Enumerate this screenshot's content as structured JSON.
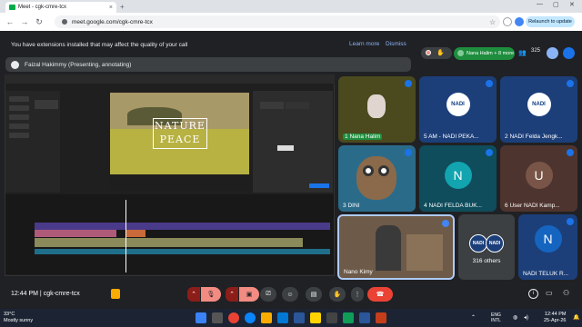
{
  "browser": {
    "tab_title": "Meet - cgk-cmre-tcx",
    "url": "meet.google.com/cgk-cmre-tcx",
    "relaunch_label": "Relaunch to update"
  },
  "banner": {
    "message": "You have extensions installed that may affect the quality of your call",
    "learn_more": "Learn more",
    "dismiss": "Dismiss"
  },
  "presenter": {
    "text": "Faizal Hakimmy (Presenting, annotating)"
  },
  "top_controls": {
    "participants_label": "Nana Halim + 8 more",
    "people_count": "325"
  },
  "shared_screen": {
    "overlay_line1": "NATURE",
    "overlay_line2": "PEACE"
  },
  "tiles": [
    {
      "label": "Nana Halim",
      "prefix": "1"
    },
    {
      "label": "AM - NADI PEKA...",
      "prefix": "5"
    },
    {
      "label": "NADI Felda Jengk...",
      "prefix": "2"
    },
    {
      "label": "DINI",
      "prefix": "3"
    },
    {
      "label": "NADI FELDA BUK...",
      "prefix": "4"
    },
    {
      "label": "User NADI Kamp...",
      "prefix": "6"
    },
    {
      "label": "Nano Kimy",
      "prefix": ""
    },
    {
      "label": "316 others",
      "prefix": ""
    },
    {
      "label": "NADI TELUK R...",
      "prefix": ""
    }
  ],
  "tile_letters": {
    "felda_buk": "N",
    "user_kamp": "U",
    "teluk": "N"
  },
  "nadi_logo_text": "NADI",
  "bottom_bar": {
    "time": "12:44 PM",
    "separator": "|",
    "meeting_code": "cgk-cmre-tcx"
  },
  "taskbar": {
    "temp": "33°C",
    "weather": "Mostly sunny",
    "lang1": "ENG",
    "lang2": "INTL",
    "time": "12:44 PM",
    "date": "25-Apr-26"
  },
  "colors": {
    "meet_bg": "#202124",
    "end_call": "#ea4335",
    "muted_red": "#8c1d18",
    "participants_green": "#1e8e3e",
    "tile_teal": "#0f4c5c",
    "tile_olive": "#4a4a1e",
    "tile_brown": "#4e342e",
    "nadi_blue": "#1c3f7a"
  }
}
